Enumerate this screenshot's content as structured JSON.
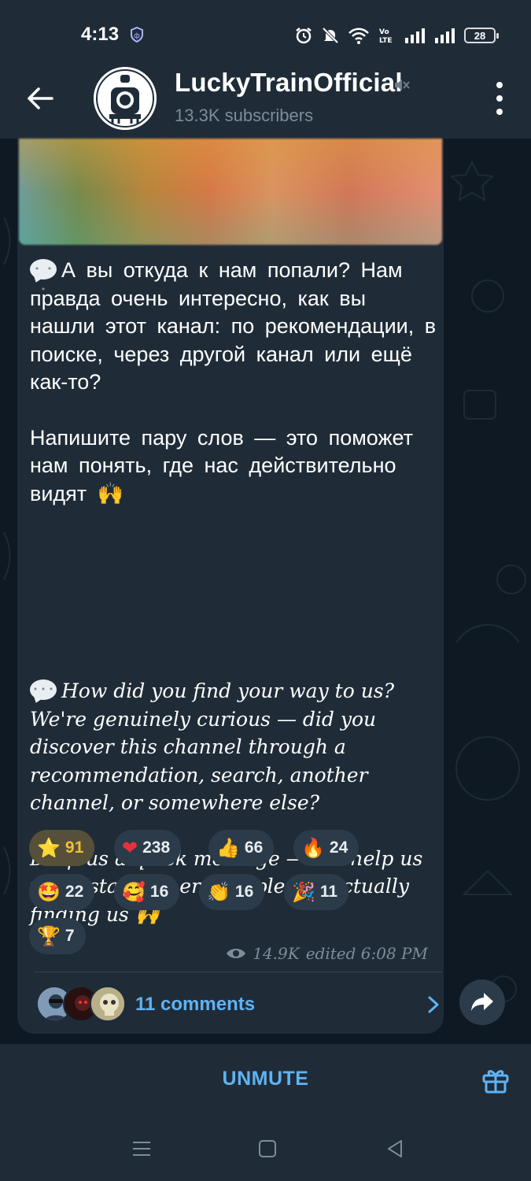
{
  "status_bar": {
    "time": "4:13",
    "battery": "28",
    "icons": [
      "vpn-icon",
      "alarm-icon",
      "mute-notifications-icon",
      "wifi-icon",
      "volte-icon",
      "signal-icon",
      "signal-icon",
      "battery-icon"
    ]
  },
  "header": {
    "title": "LuckyTrainOfficial",
    "subtitle": "13.3K subscribers",
    "muted": true
  },
  "message": {
    "ru_paragraphs": [
      "А вы откуда к нам попали? Нам правда очень интересно, как вы нашли этот канал: по рекомендации, в поиске, через другой канал или ещё как-то?",
      "Напишите пару слов — это поможет нам понять, где нас действительно видят 🙌"
    ],
    "en_paragraphs": [
      "How did you find your way to us?",
      "We're genuinely curious — did you discover this channel through a recommendation, search, another channel, or somewhere else?",
      "Drop us a quick message — it'll help us understand where people are actually finding us 🙌"
    ],
    "reactions": [
      {
        "emoji": "⭐",
        "count": "91",
        "active": true
      },
      {
        "emoji": "❤",
        "count": "238"
      },
      {
        "emoji": "👍",
        "count": "66"
      },
      {
        "emoji": "🔥",
        "count": "24"
      },
      {
        "emoji": "🤩",
        "count": "22"
      },
      {
        "emoji": "🥰",
        "count": "16"
      },
      {
        "emoji": "👏",
        "count": "16"
      },
      {
        "emoji": "🎉",
        "count": "11"
      },
      {
        "emoji": "🏆",
        "count": "7"
      }
    ],
    "views": "14.9K",
    "edited": "edited 6:08 PM",
    "comments_label": "11 comments"
  },
  "bottom": {
    "unmute_label": "UNMUTE"
  },
  "colors": {
    "accent": "#5fb3f3",
    "header_bg": "#1f2c38",
    "chat_bg": "#0e1923",
    "bubble_bg": "#1f2c38",
    "star_reaction": "#f0c035"
  }
}
